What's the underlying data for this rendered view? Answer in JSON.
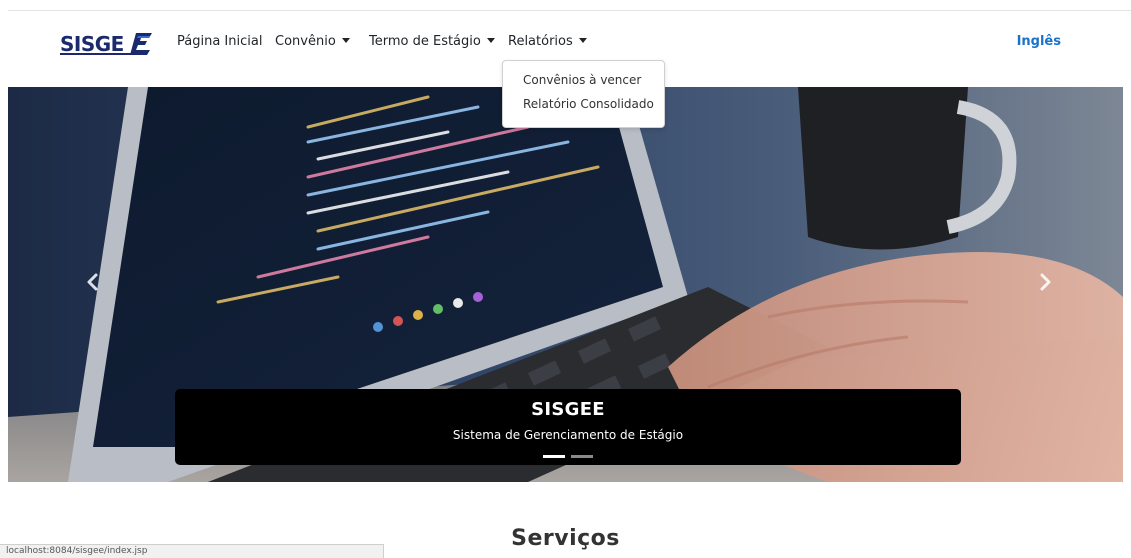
{
  "brand": {
    "name": "SISGEE"
  },
  "nav": {
    "items": [
      {
        "label": "Página Inicial",
        "has_dropdown": false
      },
      {
        "label": "Convênio",
        "has_dropdown": true
      },
      {
        "label": "Termo de Estágio",
        "has_dropdown": true
      },
      {
        "label": "Relatórios",
        "has_dropdown": true
      }
    ],
    "language": "Inglês"
  },
  "dropdown": {
    "items": [
      "Convênios à vencer",
      "Relatório Consolidado"
    ]
  },
  "carousel": {
    "caption_title": "SISGEE",
    "caption_text": "Sistema de Gerenciamento de Estágio",
    "slide_count": 2,
    "active_slide": 1
  },
  "section": {
    "title": "Serviços"
  },
  "statusbar": {
    "url": "localhost:8084/sisgee/index.jsp"
  },
  "colors": {
    "link": "#1a73c9",
    "logo": "#1a2a6c",
    "caption_bg": "#000000"
  },
  "icons": [
    "chevron-left-icon",
    "chevron-right-icon",
    "caret-down-icon"
  ]
}
